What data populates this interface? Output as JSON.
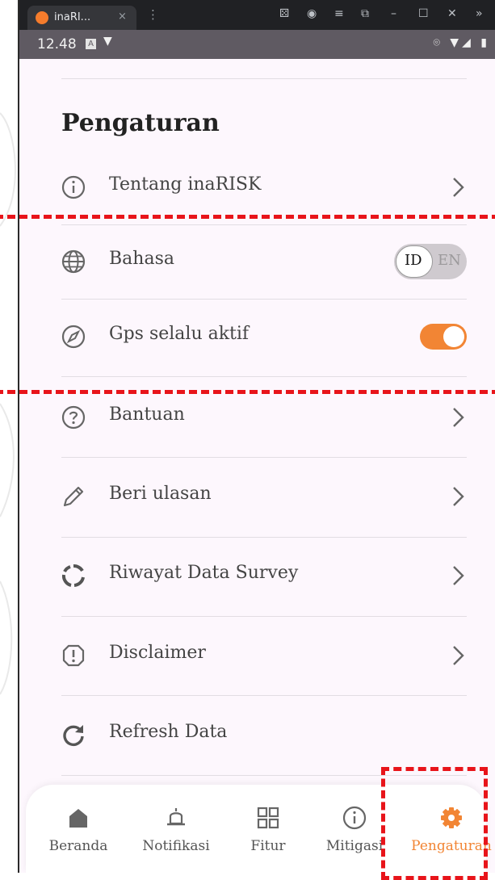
{
  "window": {
    "tab_title": "inaRI...",
    "tab_close": "×",
    "menu": "⋮",
    "controls": [
      "⚄",
      "◉",
      "≡",
      "⧉",
      "–",
      "☐",
      "✕",
      "»"
    ]
  },
  "status_bar": {
    "time": "12.48",
    "a_badge": "A",
    "down": "▼",
    "right": "⌾ ▼◢ ▮"
  },
  "page": {
    "title": "Pengaturan",
    "rows": [
      {
        "label": "Tentang inaRISK",
        "icon": "info-icon",
        "trail": "chevron"
      },
      {
        "label": "Bahasa",
        "icon": "globe-icon",
        "trail": "lang-toggle"
      },
      {
        "label": "Gps selalu aktif",
        "icon": "compass-icon",
        "trail": "switch-on"
      },
      {
        "label": "Bantuan",
        "icon": "help-icon",
        "trail": "chevron"
      },
      {
        "label": "Beri ulasan",
        "icon": "pencil-icon",
        "trail": "chevron"
      },
      {
        "label": "Riwayat Data Survey",
        "icon": "history-icon",
        "trail": "chevron"
      },
      {
        "label": "Disclaimer",
        "icon": "warning-icon",
        "trail": "chevron"
      },
      {
        "label": "Refresh Data",
        "icon": "refresh-icon",
        "trail": "none"
      }
    ],
    "language": {
      "id": "ID",
      "en": "EN",
      "selected": "ID"
    },
    "gps_enabled": true
  },
  "bottom_nav": [
    {
      "label": "Beranda",
      "icon": "home-icon",
      "active": false
    },
    {
      "label": "Notifikasi",
      "icon": "bell-icon",
      "active": false
    },
    {
      "label": "Fitur",
      "icon": "grid-icon",
      "active": false
    },
    {
      "label": "Mitigasi",
      "icon": "info-icon",
      "active": false
    },
    {
      "label": "Pengaturan",
      "icon": "gear-icon",
      "active": true
    }
  ],
  "colors": {
    "accent": "#f28534",
    "annotation": "#e8141a",
    "background": "#fdf7fd"
  }
}
